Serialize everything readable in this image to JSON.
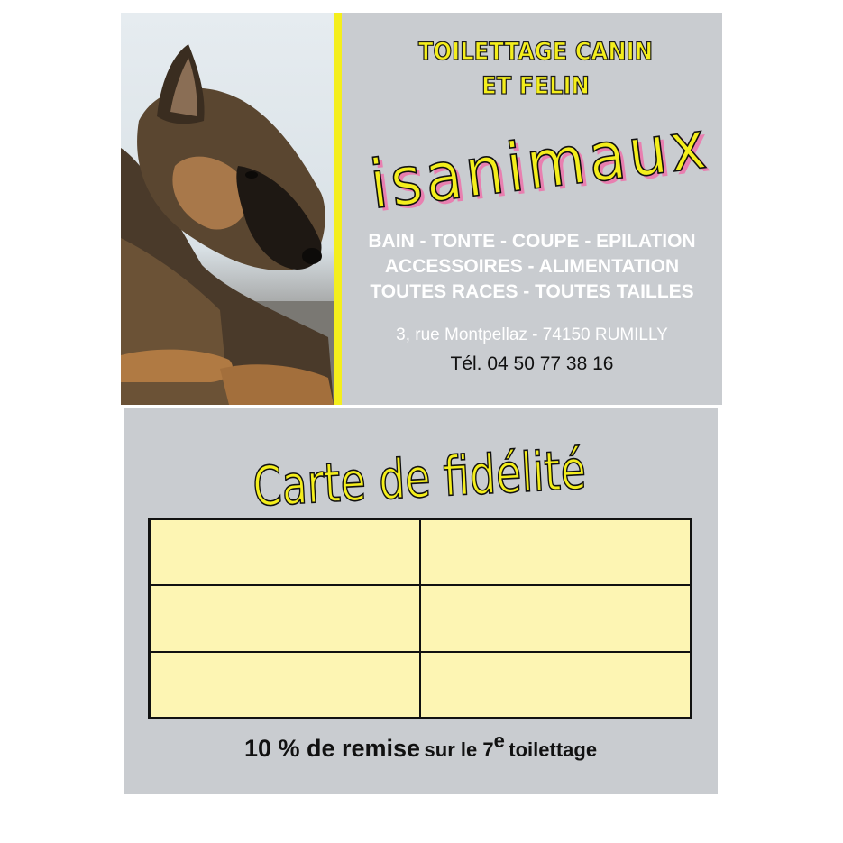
{
  "front": {
    "title_line1": "TOILETTAGE CANIN",
    "title_line2": "ET FELIN",
    "brand_name": "isanimaux",
    "services": [
      "BAIN - TONTE - COUPE - EPILATION",
      "ACCESSOIRES - ALIMENTATION",
      "TOUTES RACES - TOUTES TAILLES"
    ],
    "address": "3, rue Montpellaz - 74150 RUMILLY",
    "phone": "Tél. 04 50 77 38 16"
  },
  "back": {
    "title": "Carte de fidélité",
    "stamp_grid": {
      "rows": 3,
      "columns": 2
    },
    "discount_main": "10 % de remise",
    "discount_rest": "sur le 7",
    "discount_sup": "e",
    "discount_end": "toilettage"
  },
  "colors": {
    "card_background": "#c9ccd0",
    "accent_yellow": "#f4ee1c",
    "stamp_cell": "#fdf5b3",
    "text_dark": "#111111",
    "text_light": "#ffffff"
  },
  "icons": {
    "photo": "german-shepherd-dog-photo"
  }
}
